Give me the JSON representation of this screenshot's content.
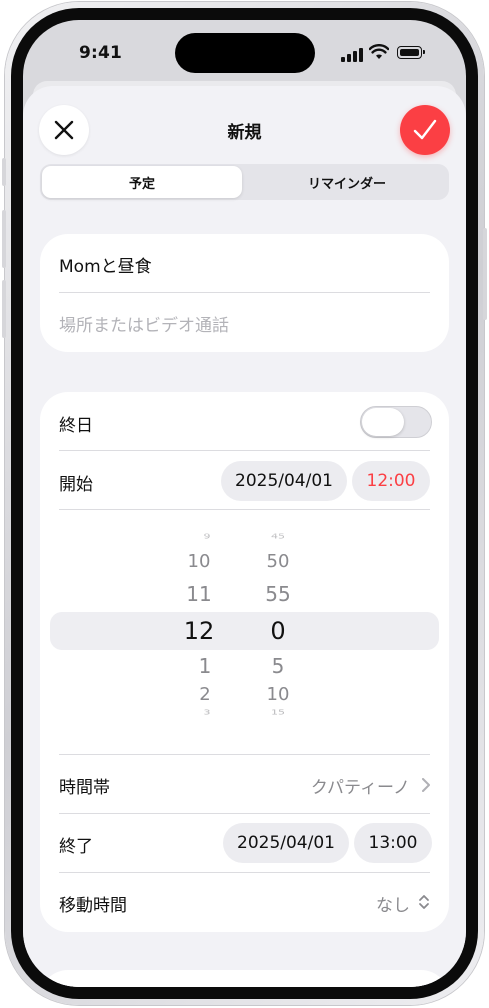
{
  "status_bar": {
    "time": "9:41"
  },
  "header": {
    "title": "新規"
  },
  "segments": {
    "event": "予定",
    "reminder": "リマインダー"
  },
  "event": {
    "title_value": "Momと昼食",
    "location_placeholder": "場所またはビデオ通話"
  },
  "all_day": {
    "label": "終日",
    "enabled": false
  },
  "start": {
    "label": "開始",
    "date": "2025/04/01",
    "time": "12:00"
  },
  "picker": {
    "hours": [
      "9",
      "10",
      "11",
      "12",
      "1",
      "2",
      "3"
    ],
    "minutes": [
      "45",
      "50",
      "55",
      "0",
      "5",
      "10",
      "15"
    ],
    "selected_hour": "12",
    "selected_minute": "0"
  },
  "timezone": {
    "label": "時間帯",
    "value": "クパティーノ"
  },
  "end": {
    "label": "終了",
    "date": "2025/04/01",
    "time": "13:00"
  },
  "travel_time": {
    "label": "移動時間",
    "value": "なし"
  },
  "colors": {
    "accent": "#fb3f44",
    "background": "#f2f2f6",
    "card": "#ffffff"
  },
  "icons": [
    "close-icon",
    "checkmark-icon",
    "chevron-right-icon",
    "chevron-up-down-icon",
    "wifi-icon",
    "battery-icon",
    "signal-icon"
  ]
}
